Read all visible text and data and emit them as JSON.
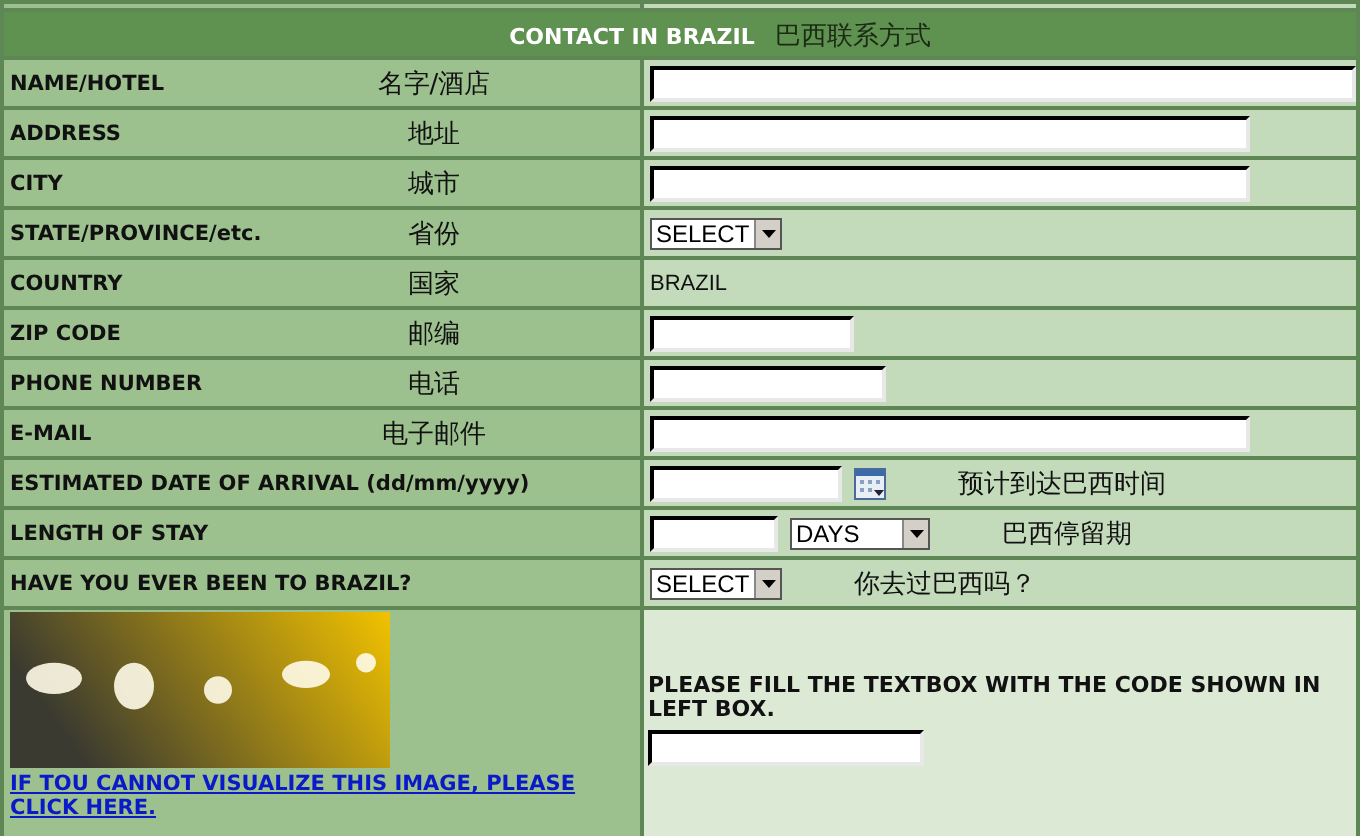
{
  "section": {
    "title": "CONTACT IN BRAZIL",
    "title_zh": "巴西联系方式"
  },
  "rows": [
    {
      "label": "NAME/HOTEL",
      "label_zh": "名字/酒店",
      "kind": "input"
    },
    {
      "label": "ADDRESS",
      "label_zh": "地址",
      "kind": "input"
    },
    {
      "label": "CITY",
      "label_zh": "城市",
      "kind": "input"
    },
    {
      "label": "STATE/PROVINCE/etc.",
      "label_zh": "省份",
      "kind": "select",
      "value": "SELECT"
    },
    {
      "label": "COUNTRY",
      "label_zh": "国家",
      "kind": "static",
      "value": "BRAZIL"
    },
    {
      "label": "ZIP CODE",
      "label_zh": "邮编",
      "kind": "input"
    },
    {
      "label": "PHONE NUMBER",
      "label_zh": "电话",
      "kind": "input"
    },
    {
      "label": "E-MAIL",
      "label_zh": "电子邮件",
      "kind": "input"
    },
    {
      "label": "ESTIMATED DATE OF ARRIVAL (dd/mm/yyyy)",
      "kind": "date",
      "note": "预计到达巴西时间"
    },
    {
      "label": "LENGTH OF STAY",
      "kind": "duration",
      "value": "DAYS",
      "note": "巴西停留期"
    },
    {
      "label": "HAVE YOU EVER BEEN TO BRAZIL?",
      "kind": "select",
      "value": "SELECT",
      "note": "你去过巴西吗？"
    }
  ],
  "captcha": {
    "link": "IF TOU CANNOT VISUALIZE THIS IMAGE, PLEASE CLICK HERE.",
    "instruction": "PLEASE FILL THE TEXTBOX WITH THE CODE SHOWN IN LEFT BOX."
  }
}
